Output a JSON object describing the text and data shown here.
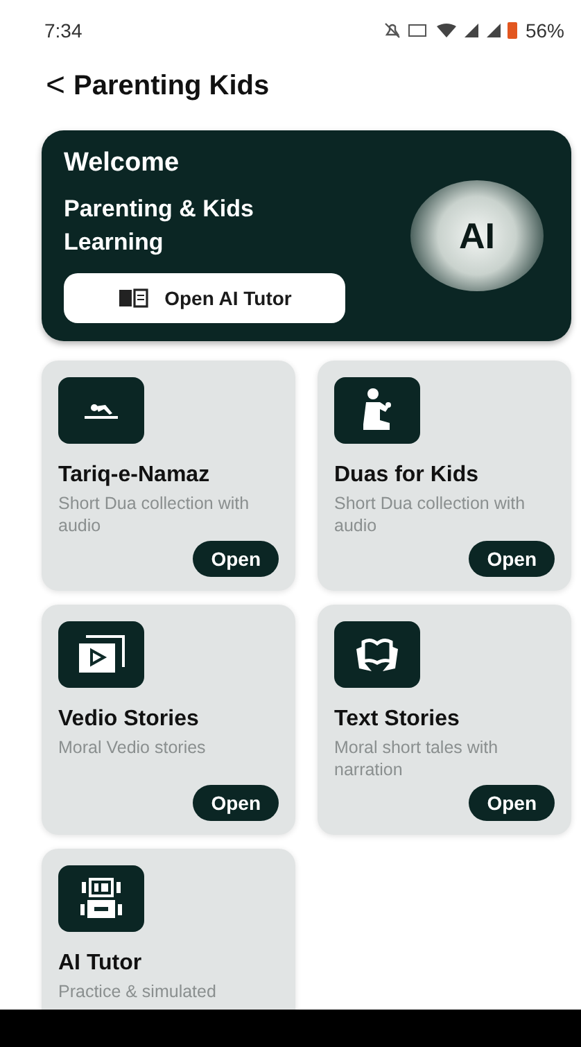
{
  "status_bar": {
    "time": "7:34",
    "battery": "56%"
  },
  "header": {
    "back": "<",
    "title": "Parenting Kids"
  },
  "hero": {
    "welcome": "Welcome",
    "subtitle": "Parenting & Kids Learning",
    "button": "Open AI Tutor",
    "badge": "AI"
  },
  "cards": [
    {
      "title": "Tariq-e-Namaz",
      "description": "Short Dua collection with audio",
      "button": "Open"
    },
    {
      "title": "Duas for Kids",
      "description": "Short Dua collection with audio",
      "button": "Open"
    },
    {
      "title": "Vedio Stories",
      "description": "Moral Vedio stories",
      "button": "Open"
    },
    {
      "title": "Text Stories",
      "description": "Moral short tales with narration",
      "button": "Open"
    },
    {
      "title": "AI Tutor",
      "description": "Practice & simulated"
    }
  ]
}
